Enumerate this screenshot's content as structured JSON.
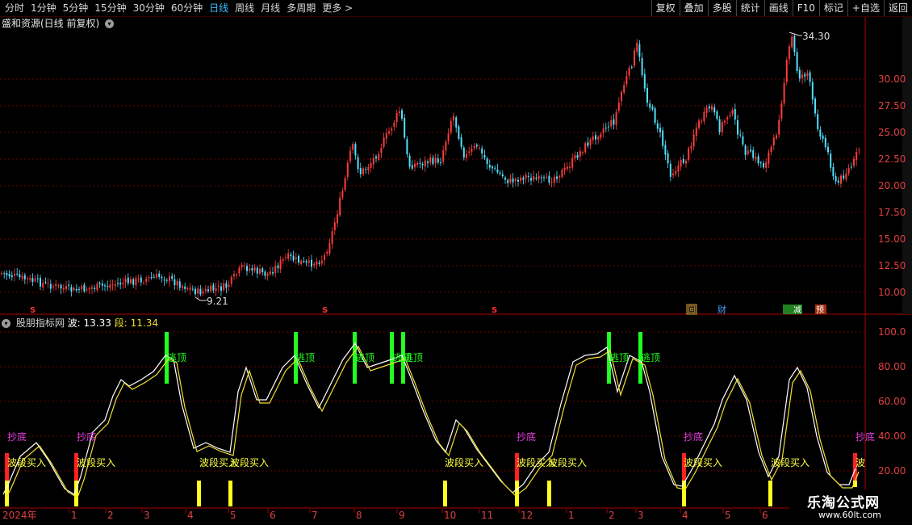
{
  "toolbar": {
    "periods": [
      "分时",
      "1分钟",
      "5分钟",
      "15分钟",
      "30分钟",
      "60分钟",
      "日线",
      "周线",
      "月线",
      "多周期",
      "更多 >"
    ],
    "active_period": "日线",
    "actions": [
      "复权",
      "叠加",
      "多股",
      "统计",
      "画线",
      "F10",
      "标记",
      "+自选",
      "返回"
    ]
  },
  "stock": {
    "title": "盛和资源(日线 前复权)"
  },
  "price_chart": {
    "axis_labels": [
      "30.00",
      "27.50",
      "25.00",
      "22.50",
      "20.00",
      "17.50",
      "15.00",
      "12.50",
      "10.00"
    ],
    "high_marker": "34.30",
    "low_marker": "9.21",
    "s_markers": [
      "S",
      "S",
      "S"
    ],
    "event_badges": [
      "回",
      "财",
      "减",
      "预"
    ]
  },
  "indicator": {
    "name": "股朋指标网",
    "wave_label": "波:",
    "wave_value": "13.33",
    "seg_label": "段:",
    "seg_value": "11.34",
    "axis_labels": [
      "100.0",
      "80.00",
      "60.00",
      "40.00",
      "20.00"
    ],
    "labels": {
      "escape_top": "逃顶",
      "bottom_fish": "抄底",
      "band_buy": "波段买入",
      "band_buy_cut": "波"
    }
  },
  "time_axis": [
    "2024年",
    "1",
    "2",
    "3",
    "4",
    "5",
    "6",
    "7",
    "8",
    "9",
    "10",
    "11",
    "12",
    "1",
    "2",
    "3",
    "4",
    "5",
    "6"
  ],
  "colors": {
    "up": "#ff3b3b",
    "down": "#52e0ff",
    "wave_line": "#ffffff",
    "seg_line": "#f0e030",
    "escape": "#20ff20",
    "bottom": "#e040e0",
    "buy_red": "#ff2020",
    "buy_yellow": "#ffff20",
    "active": "#38c0ff"
  },
  "watermark": {
    "name": "乐淘公式网",
    "url": "www.60lt.com"
  }
}
